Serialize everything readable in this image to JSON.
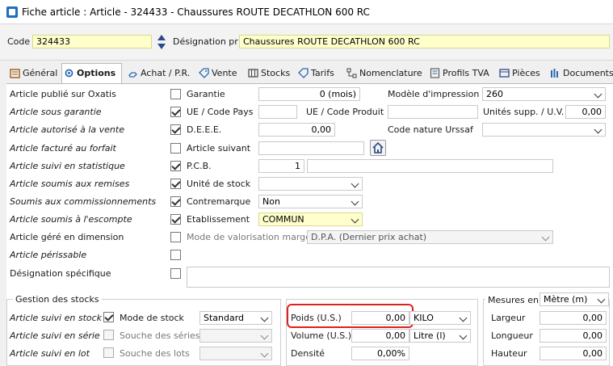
{
  "window": {
    "title": "Fiche article : Article - 324433 - Chaussures ROUTE DECATHLON 600 RC"
  },
  "header": {
    "code_label": "Code",
    "code_value": "324433",
    "designation_label": "Désignation pr",
    "designation_value": "Chaussures ROUTE DECATHLON 600 RC"
  },
  "tabs": [
    {
      "label": "Général"
    },
    {
      "label": "Options"
    },
    {
      "label": "Achat / P.R."
    },
    {
      "label": "Vente"
    },
    {
      "label": "Stocks"
    },
    {
      "label": "Tarifs"
    },
    {
      "label": "Nomenclature"
    },
    {
      "label": "Profils TVA"
    },
    {
      "label": "Pièces"
    },
    {
      "label": "Documents"
    }
  ],
  "options": {
    "left": [
      {
        "label": "Article publié sur Oxatis",
        "checked": false
      },
      {
        "label": "Article sous garantie",
        "checked": true
      },
      {
        "label": "Article autorisé à la vente",
        "checked": true
      },
      {
        "label": "Article facturé au forfait",
        "checked": false
      },
      {
        "label": "Article suivi en statistique",
        "checked": true
      },
      {
        "label": "Article soumis aux remises",
        "checked": true
      },
      {
        "label": "Soumis aux commissionnements",
        "checked": true
      },
      {
        "label": "Article soumis à l'escompte",
        "checked": true
      },
      {
        "label": "Article géré en dimension",
        "checked": false
      },
      {
        "label": "Article périssable",
        "checked": false
      },
      {
        "label": "Désignation spécifique",
        "checked": false
      }
    ],
    "garantie_label": "Garantie",
    "garantie_value": "0 (mois)",
    "modele_label": "Modèle d'impression",
    "modele_value": "260",
    "ue_label": "UE / Code Pays",
    "ue_produit_label": "UE / Code Produit",
    "unites_label": "Unités supp. / U.V.",
    "unites_value": "0,00",
    "deee_label": "D.E.E.E.",
    "deee_value": "0,00",
    "ursaf_label": "Code nature Urssaf",
    "article_suivant_label": "Article suivant",
    "pcb_label": "P.C.B.",
    "pcb_value": "1",
    "unite_stock_label": "Unité de stock",
    "contremarque_label": "Contremarque",
    "contremarque_value": "Non",
    "etablissement_label": "Etablissement",
    "etablissement_value": "COMMUN",
    "valorisation_label": "Mode de valorisation marge",
    "valorisation_value": "D.P.A. (Dernier prix achat)"
  },
  "stocks": {
    "title": "Gestion des stocks",
    "rows": [
      {
        "label": "Article suivi en stock",
        "checked": true,
        "field_label": "Mode de stock",
        "field_value": "Standard"
      },
      {
        "label": "Article suivi en série",
        "checked": false,
        "field_label": "Souche des séries",
        "field_value": ""
      },
      {
        "label": "Article suivi en lot",
        "checked": false,
        "field_label": "Souche des lots",
        "field_value": ""
      }
    ]
  },
  "physique": {
    "poids_label": "Poids (U.S.)",
    "poids_value": "0,00",
    "poids_unit": "KILO",
    "volume_label": "Volume (U.S.)",
    "volume_value": "0,00",
    "volume_unit": "Litre (l)",
    "densite_label": "Densité",
    "densite_value": "0,00%"
  },
  "mesures": {
    "title": "Mesures en",
    "unit": "Mètre (m)",
    "largeur_label": "Largeur",
    "largeur_value": "0,00",
    "longueur_label": "Longueur",
    "longueur_value": "0,00",
    "hauteur_label": "Hauteur",
    "hauteur_value": "0,00"
  }
}
